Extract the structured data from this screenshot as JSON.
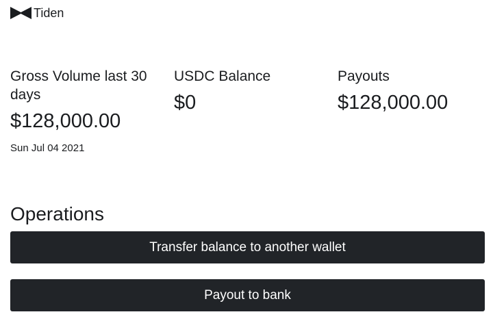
{
  "brand": {
    "name": "Tiden",
    "icon": "tiden-logo-icon"
  },
  "stats": {
    "gross_volume": {
      "title": "Gross Volume last 30 days",
      "value": "$128,000.00",
      "date": "Sun Jul 04 2021"
    },
    "usdc_balance": {
      "title": "USDC Balance",
      "value": "$0"
    },
    "payouts": {
      "title": "Payouts",
      "value": "$128,000.00"
    }
  },
  "operations": {
    "heading": "Operations",
    "transfer_label": "Transfer balance to another wallet",
    "payout_label": "Payout to bank"
  },
  "colors": {
    "button_bg": "#212428",
    "button_text": "#ffffff",
    "text": "#1a1c1f"
  }
}
